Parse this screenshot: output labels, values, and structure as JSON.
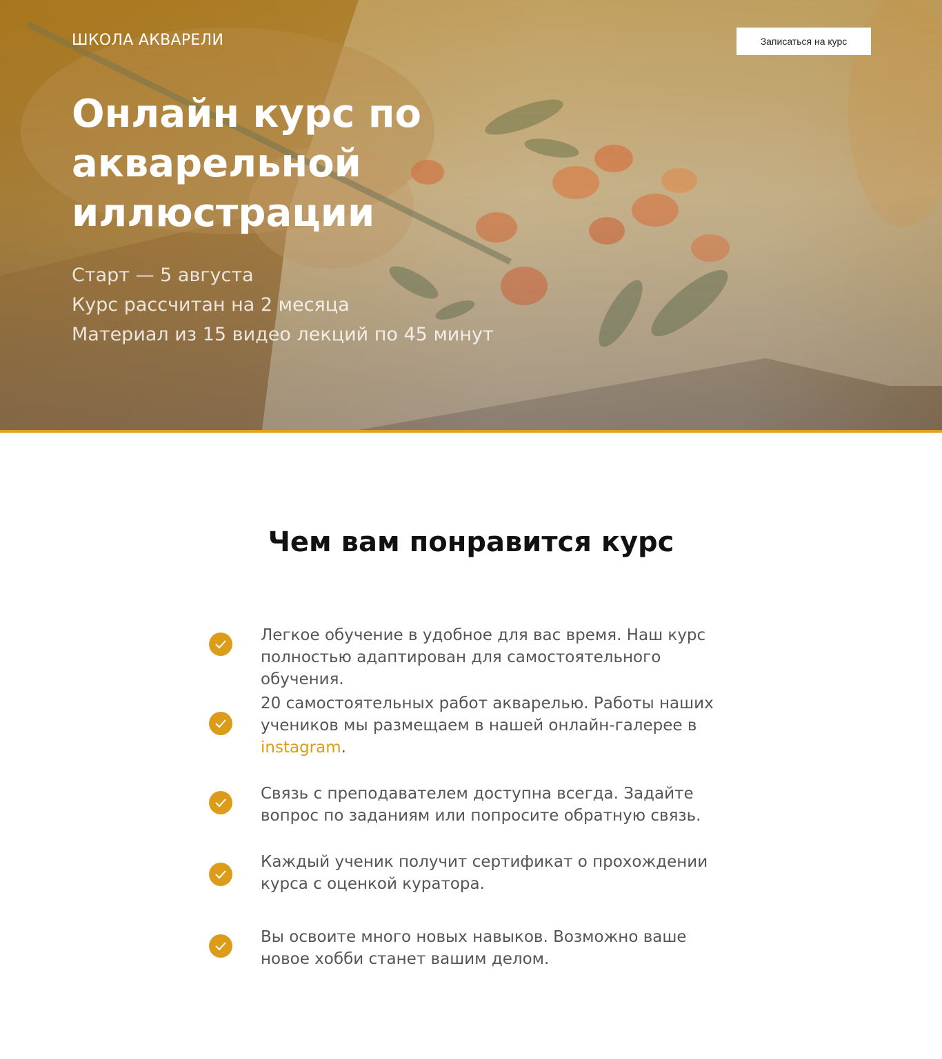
{
  "header": {
    "logo": "ШКОЛА АКВАРЕЛИ",
    "cta_label": "Записаться на курс"
  },
  "hero": {
    "title": "Онлайн курс по акварельной иллюстрации",
    "facts": [
      "Старт — 5 августа",
      "Курс рассчитан на 2 месяца",
      "Материал из 15 видео лекций по 45 минут"
    ]
  },
  "benefits": {
    "title": "Чем вам понравится курс",
    "items": [
      {
        "text": "Легкое обучение в удобное для вас время. Наш курс полностью адаптирован для самостоятельного обучения."
      },
      {
        "text_before": "20 самостоятельных работ акварелью. Работы наших учеников мы размещаем в нашей онлайн-галерее в ",
        "link": "instagram",
        "text_after": "."
      },
      {
        "text": "Связь с преподавателем доступна всегда. Задайте вопрос по заданиям или попросите обратную связь."
      },
      {
        "text": "Каждый ученик получит сертификат о прохождении курса с оценкой куратора."
      },
      {
        "text": "Вы освоите много новых навыков. Возможно ваше новое хобби станет вашим делом."
      }
    ]
  },
  "colors": {
    "accent": "#dc9c1a",
    "accent_line": "#e0a020"
  },
  "icons": {
    "check": "check-icon"
  }
}
